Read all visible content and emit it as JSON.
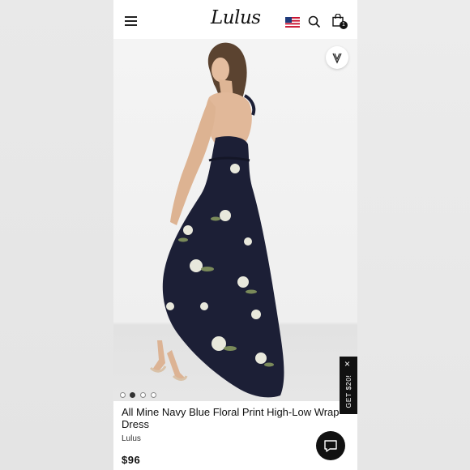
{
  "header": {
    "logo_text": "Lulus",
    "menu_icon": "hamburger-menu-icon",
    "flag_icon": "us-flag-icon",
    "search_icon": "search-icon",
    "bag_icon": "shopping-bag-icon",
    "bag_count": "1"
  },
  "gallery": {
    "favorite_icon": "heart-v-icon",
    "slide_count": 4,
    "active_slide": 2
  },
  "promo": {
    "label": "GET $20!",
    "close_symbol": "×"
  },
  "product": {
    "title": "All Mine Navy Blue Floral Print High-Low Wrap Dress",
    "brand": "Lulus",
    "price": "$96"
  },
  "chat": {
    "icon": "chat-bubble-icon"
  },
  "colors": {
    "dress_navy": "#1c1f36",
    "accent_black": "#111111",
    "floral_white": "#e8e8dc",
    "leaf_green": "#7a8a5a"
  }
}
